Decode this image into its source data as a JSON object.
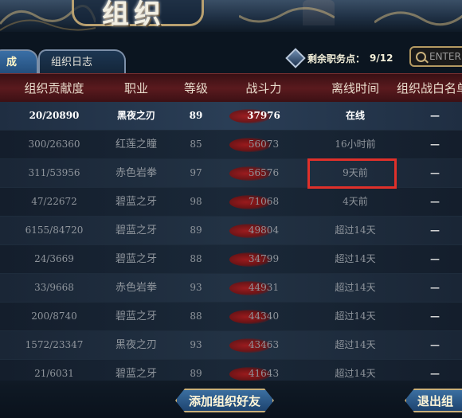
{
  "banner": {
    "title": "组织"
  },
  "tabs": [
    {
      "label": "成员",
      "active": true
    },
    {
      "label": "组织日志",
      "active": false
    }
  ],
  "points": {
    "label": "剩余职务点：",
    "value": "9/12"
  },
  "search": {
    "placeholder": "ENTER"
  },
  "table": {
    "columns": [
      "组织贡献度",
      "职业",
      "等级",
      "战斗力",
      "离线时间",
      "组织战白名单"
    ],
    "rows": [
      {
        "contribution": "20/20890",
        "profession": "黑夜之刃",
        "level": "89",
        "power": "37976",
        "offline": "在线",
        "whitelist": "—"
      },
      {
        "contribution": "300/26360",
        "profession": "红莲之瞳",
        "level": "85",
        "power": "56073",
        "offline": "16小时前",
        "whitelist": "—"
      },
      {
        "contribution": "311/53956",
        "profession": "赤色岩拳",
        "level": "97",
        "power": "56576",
        "offline": "9天前",
        "whitelist": "—"
      },
      {
        "contribution": "47/22672",
        "profession": "碧蓝之牙",
        "level": "98",
        "power": "71068",
        "offline": "4天前",
        "whitelist": "—"
      },
      {
        "contribution": "6155/84720",
        "profession": "碧蓝之牙",
        "level": "89",
        "power": "49804",
        "offline": "超过14天",
        "whitelist": "—"
      },
      {
        "contribution": "24/3669",
        "profession": "碧蓝之牙",
        "level": "88",
        "power": "34799",
        "offline": "超过14天",
        "whitelist": "—"
      },
      {
        "contribution": "33/9668",
        "profession": "赤色岩拳",
        "level": "93",
        "power": "44931",
        "offline": "超过14天",
        "whitelist": "—"
      },
      {
        "contribution": "200/8740",
        "profession": "碧蓝之牙",
        "level": "88",
        "power": "44340",
        "offline": "超过14天",
        "whitelist": "—"
      },
      {
        "contribution": "1572/23347",
        "profession": "黑夜之刃",
        "level": "93",
        "power": "43463",
        "offline": "超过14天",
        "whitelist": "—"
      },
      {
        "contribution": "21/6031",
        "profession": "碧蓝之牙",
        "level": "89",
        "power": "41643",
        "offline": "超过14天",
        "whitelist": "—"
      }
    ]
  },
  "buttons": {
    "add_friend": "添加组织好友",
    "quit": "退出组"
  },
  "colors": {
    "header_bg": "#5a1a1e",
    "tab_active": "#3a6fa6",
    "highlight": "#e0302a",
    "gold_border": "#c9b07a"
  }
}
